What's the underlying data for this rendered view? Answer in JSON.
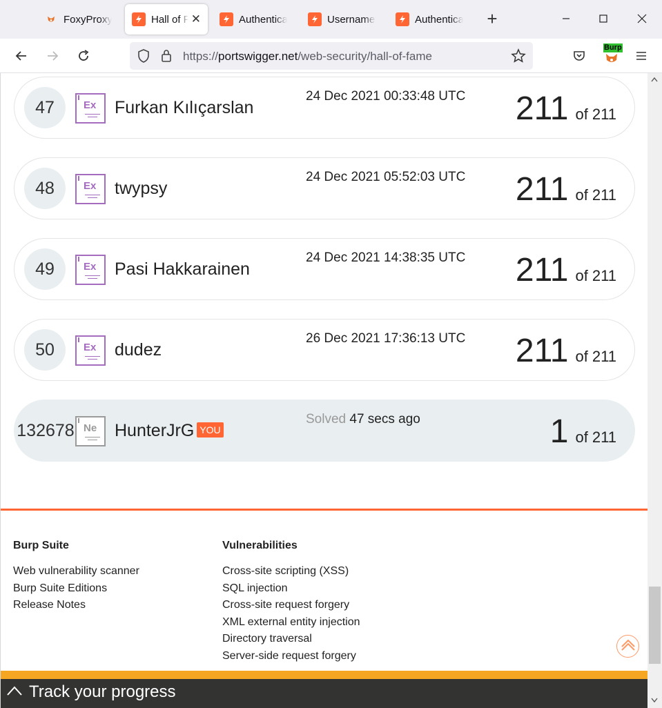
{
  "browser": {
    "tabs": [
      {
        "label": "FoxyProxy Options",
        "active": false
      },
      {
        "label": "Hall of Fame",
        "active": true
      },
      {
        "label": "Authentication",
        "active": false
      },
      {
        "label": "Username enumeration",
        "active": false
      },
      {
        "label": "Authentication",
        "active": false
      }
    ],
    "new_tab": "+",
    "url_scheme": "https://",
    "url_host": "portswigger.net",
    "url_path": "/web-security/hall-of-fame",
    "extension_label": "Burp"
  },
  "leaderboard": [
    {
      "rank": "47",
      "badge": "Ex",
      "name": "Furkan Kılıçarslan",
      "when": "24 Dec 2021 00:33:48 UTC",
      "solved": "211",
      "total_label": "of 211"
    },
    {
      "rank": "48",
      "badge": "Ex",
      "name": "twypsy",
      "when": "24 Dec 2021 05:52:03 UTC",
      "solved": "211",
      "total_label": "of 211"
    },
    {
      "rank": "49",
      "badge": "Ex",
      "name": "Pasi Hakkarainen",
      "when": "24 Dec 2021 14:38:35 UTC",
      "solved": "211",
      "total_label": "of 211"
    },
    {
      "rank": "50",
      "badge": "Ex",
      "name": "dudez",
      "when": "26 Dec 2021 17:36:13 UTC",
      "solved": "211",
      "total_label": "of 211"
    }
  ],
  "current_user": {
    "rank": "132678",
    "badge": "Ne",
    "name": "HunterJrG",
    "you_label": "YOU",
    "when_prefix": "Solved",
    "when": "47 secs ago",
    "solved": "1",
    "total_label": "of 211"
  },
  "footer": {
    "burp_suite": {
      "heading": "Burp Suite",
      "links": [
        "Web vulnerability scanner",
        "Burp Suite Editions",
        "Release Notes"
      ]
    },
    "vulnerabilities": {
      "heading": "Vulnerabilities",
      "links": [
        "Cross-site scripting (XSS)",
        "SQL injection",
        "Cross-site request forgery",
        "XML external entity injection",
        "Directory traversal",
        "Server-side request forgery"
      ]
    }
  },
  "progress_bar": {
    "label": "Track your progress"
  },
  "colors": {
    "accent": "#ff6633",
    "expert_badge": "#a46bbf",
    "progress_bg": "#333332",
    "progress_strip": "#f5a623"
  }
}
